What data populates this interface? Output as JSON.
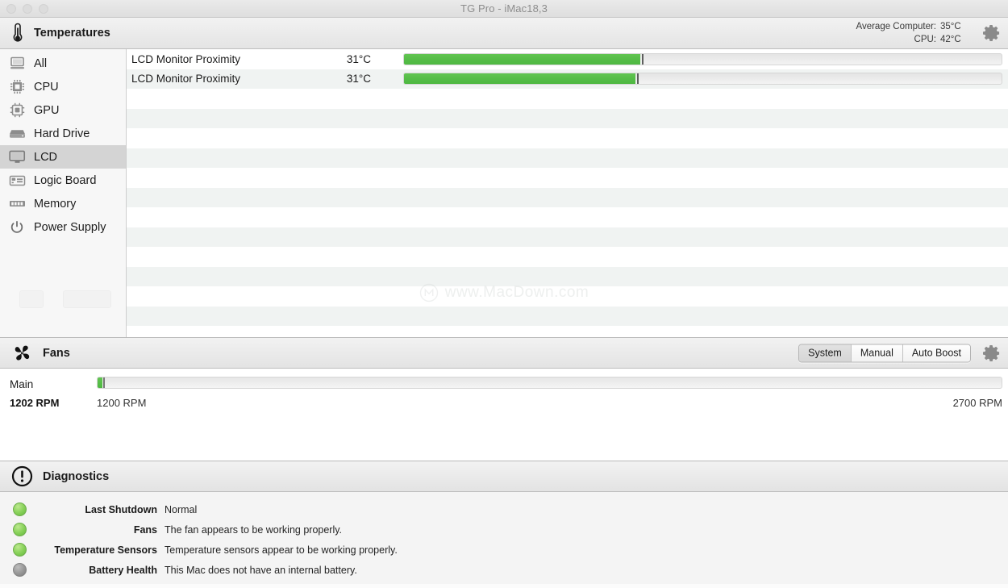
{
  "window": {
    "title": "TG Pro - iMac18,3",
    "traffic_lights": [
      "close",
      "minimize",
      "zoom"
    ]
  },
  "temperatures": {
    "section_title": "Temperatures",
    "section_icon": "thermometer-icon",
    "gear_icon": "gear-icon",
    "summary": [
      {
        "label": "Average Computer:",
        "value": "35°C"
      },
      {
        "label": "CPU:",
        "value": "42°C"
      }
    ],
    "sidebar": {
      "items": [
        {
          "label": "All",
          "icon": "computer-icon",
          "selected": false
        },
        {
          "label": "CPU",
          "icon": "cpu-chip-icon",
          "selected": false
        },
        {
          "label": "GPU",
          "icon": "gpu-chip-icon",
          "selected": false
        },
        {
          "label": "Hard Drive",
          "icon": "hard-drive-icon",
          "selected": false
        },
        {
          "label": "LCD",
          "icon": "display-icon",
          "selected": true
        },
        {
          "label": "Logic Board",
          "icon": "logic-board-icon",
          "selected": false
        },
        {
          "label": "Memory",
          "icon": "memory-icon",
          "selected": false
        },
        {
          "label": "Power Supply",
          "icon": "power-icon",
          "selected": false
        }
      ]
    },
    "rows": [
      {
        "name": "LCD Monitor Proximity",
        "value": "31°C",
        "fill_percent": 39.5
      },
      {
        "name": "LCD Monitor Proximity",
        "value": "31°C",
        "fill_percent": 38.7
      }
    ],
    "empty_row_count": 12,
    "bar_color": "#56bd48"
  },
  "watermark": {
    "text": "www.MacDown.com",
    "icon": "macdown-logo-icon"
  },
  "fans": {
    "section_title": "Fans",
    "section_icon": "fan-icon",
    "gear_icon": "gear-icon",
    "modes": [
      {
        "label": "System",
        "active": true
      },
      {
        "label": "Manual",
        "active": false
      },
      {
        "label": "Auto Boost",
        "active": false
      }
    ],
    "items": [
      {
        "name": "Main",
        "current": "1202 RPM",
        "min": "1200 RPM",
        "max": "2700 RPM",
        "fill_percent": 0.5
      }
    ]
  },
  "diagnostics": {
    "section_title": "Diagnostics",
    "section_icon": "exclamation-circle-icon",
    "rows": [
      {
        "label": "Last Shutdown",
        "text": "Normal",
        "status": "green"
      },
      {
        "label": "Fans",
        "text": "The fan appears to be working properly.",
        "status": "green"
      },
      {
        "label": "Temperature Sensors",
        "text": "Temperature sensors appear to be working properly.",
        "status": "green"
      },
      {
        "label": "Battery Health",
        "text": "This Mac does not have an internal battery.",
        "status": "gray"
      }
    ]
  },
  "colors": {
    "accent_green": "#56bd48",
    "status_green": "#8ed45f",
    "status_gray": "#9d9d9d",
    "selected_row": "#d4d4d4"
  }
}
